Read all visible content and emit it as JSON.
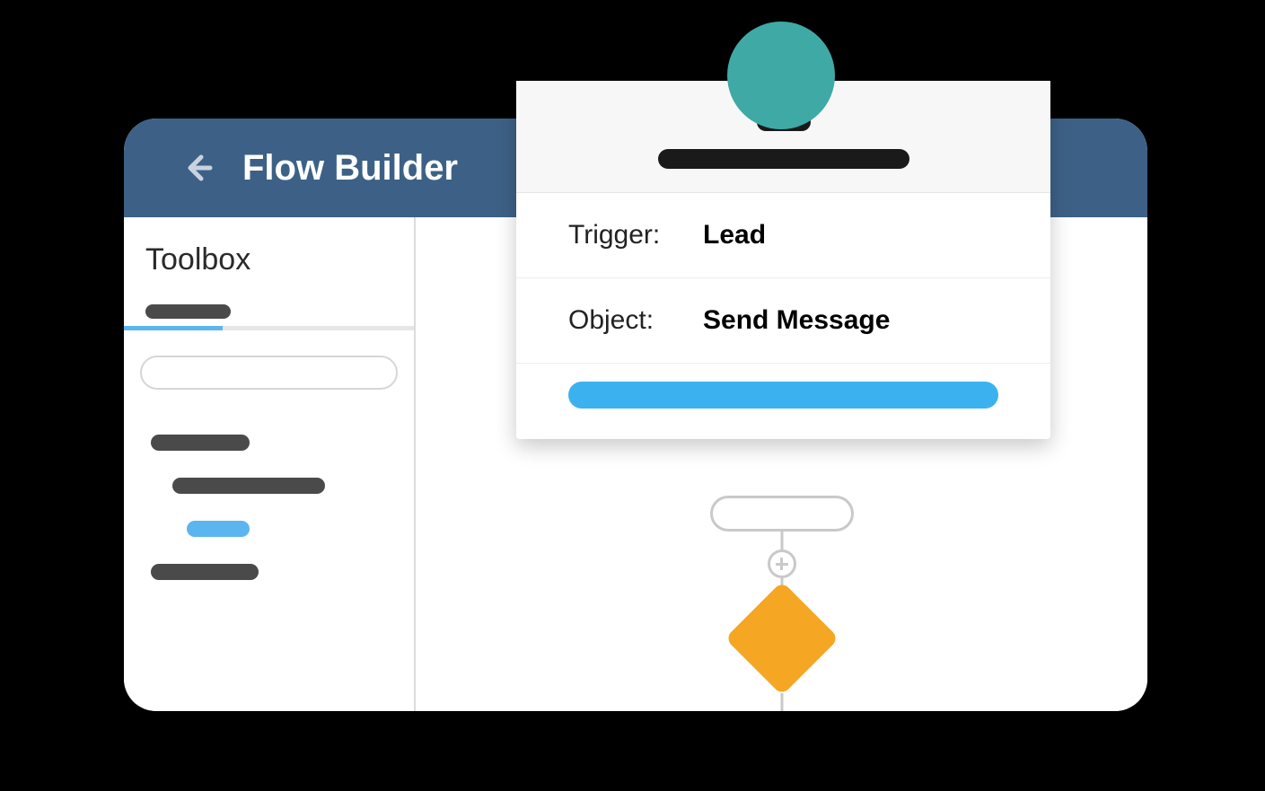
{
  "header": {
    "title": "Flow Builder"
  },
  "sidebar": {
    "title": "Toolbox"
  },
  "panel": {
    "trigger_label": "Trigger:",
    "trigger_value": "Lead",
    "object_label": "Object:",
    "object_value": "Send Message"
  }
}
